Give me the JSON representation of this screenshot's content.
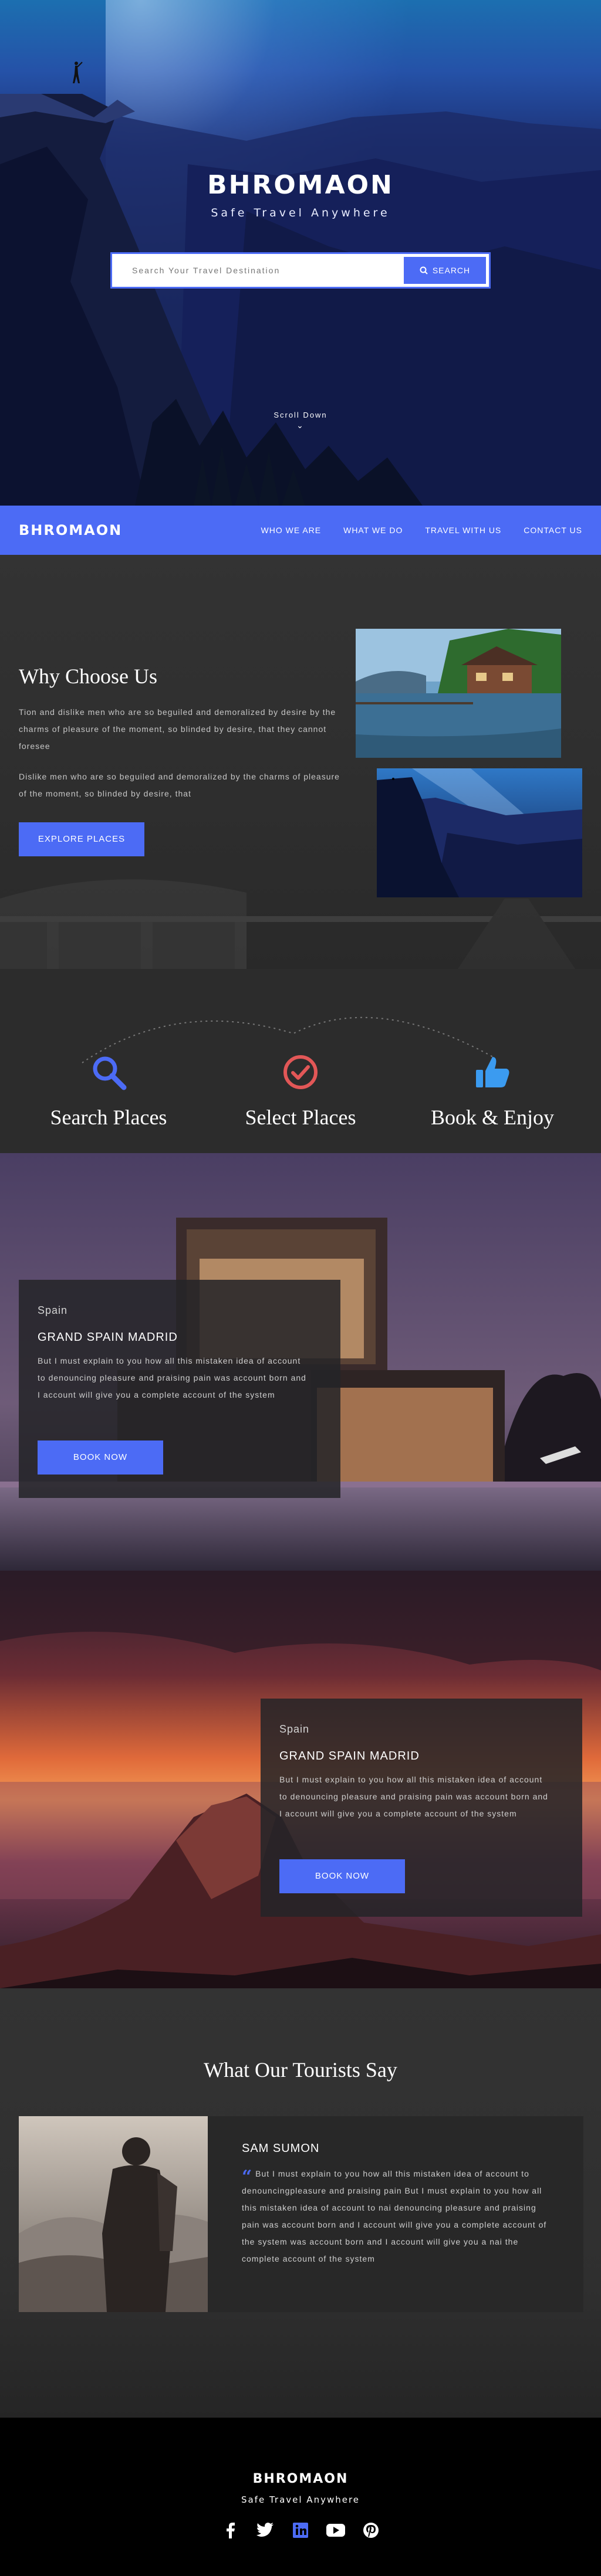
{
  "hero": {
    "title": "BHROMAON",
    "subtitle": "Safe Travel Anywhere",
    "search_placeholder": "Search Your Travel Destination",
    "search_button": "SEARCH",
    "scroll_label": "Scroll Down"
  },
  "nav": {
    "logo": "BHROMAON",
    "items": [
      {
        "label": "WHO WE ARE"
      },
      {
        "label": "WHAT WE DO"
      },
      {
        "label": "TRAVEL WITH US"
      },
      {
        "label": "CONTACT US"
      }
    ]
  },
  "why": {
    "title": "Why Choose Us",
    "paragraph1": "Tion and dislike men who are so beguiled and demoralized by desire by the charms of pleasure of the moment, so blinded by desire, that they cannot foresee",
    "paragraph2": "Dislike men who are so beguiled and demoralized by the charms of pleasure of the moment, so blinded by desire, that",
    "button": "EXPLORE PLACES"
  },
  "steps": [
    {
      "label": "Search Places",
      "icon": "search-icon",
      "color": "#4c6bf5"
    },
    {
      "label": "Select Places",
      "icon": "check-circle-icon",
      "color": "#e25757"
    },
    {
      "label": "Book & Enjoy",
      "icon": "thumbs-up-icon",
      "color": "#3b9bf0"
    }
  ],
  "destinations": [
    {
      "region": "Spain",
      "name": "GRAND SPAIN MADRID",
      "description": "But I must explain to you how all this mistaken idea of account to denouncing pleasure and praising pain was account  born and I account will give you a complete account of the system",
      "button": "BOOK NOW"
    },
    {
      "region": "Spain",
      "name": "GRAND SPAIN MADRID",
      "description": "But I must explain to you how all this mistaken idea of account to denouncing pleasure and praising pain was account  born and I account will give you a complete account of the system",
      "button": "BOOK NOW"
    }
  ],
  "testimonials": {
    "title": "What Our  Tourists Say",
    "name": "SAM SUMON",
    "quote": "But I must explain to you how all this mistaken idea of account to denouncingpleasure and praising pain  But I must explain to you how all this mistaken idea of account to nai denouncing pleasure and praising pain was account  born and I account will give you a complete account of the system was account  born and I account will give you a nai the complete account of the system"
  },
  "footer": {
    "logo": "BHROMAON",
    "tagline": "Safe Travel Anywhere",
    "socials": [
      "facebook-icon",
      "twitter-icon",
      "linkedin-icon",
      "youtube-icon",
      "pinterest-icon"
    ]
  },
  "colors": {
    "accent": "#4c6bf5",
    "dark_bg": "#2c2c2c",
    "footer_bg": "#000000"
  }
}
